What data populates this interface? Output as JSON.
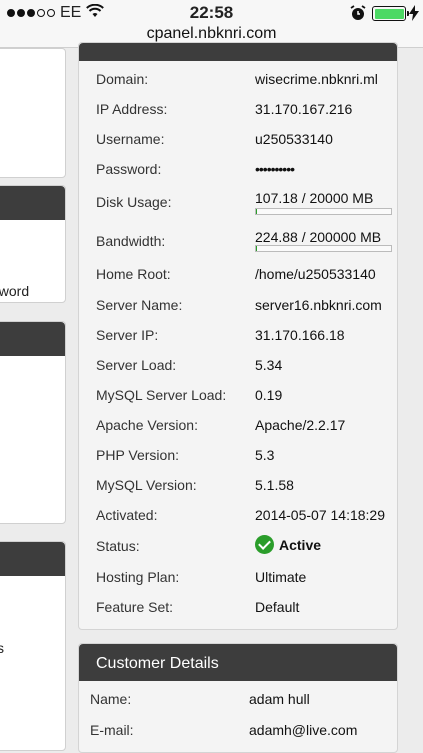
{
  "status_bar": {
    "carrier": "EE",
    "time": "22:58",
    "battery_color": "#4cd964",
    "icons": [
      "signal-dots-icon",
      "wifi-icon",
      "alarm-clock-icon",
      "battery-icon",
      "charging-bolt-icon"
    ]
  },
  "browser": {
    "url": "cpanel.nbknri.com"
  },
  "sidebar": {
    "fragment_1": "eword",
    "fragment_2": "l",
    "fragment_3": "s"
  },
  "account": {
    "domain": {
      "label": "Domain:",
      "value": "wisecrime.nbknri.ml"
    },
    "ip": {
      "label": "IP Address:",
      "value": "31.170.167.216"
    },
    "username": {
      "label": "Username:",
      "value": "u250533140"
    },
    "password": {
      "label": "Password:",
      "value": "••••••••••"
    },
    "disk": {
      "label": "Disk Usage:",
      "value": "107.18 / 20000 MB",
      "used_fraction": 0.0054
    },
    "bandwidth": {
      "label": "Bandwidth:",
      "value": "224.88 / 200000 MB",
      "used_fraction": 0.0011
    },
    "home_root": {
      "label": "Home Root:",
      "value": "/home/u250533140"
    },
    "server_name": {
      "label": "Server Name:",
      "value": "server16.nbknri.com"
    },
    "server_ip": {
      "label": "Server IP:",
      "value": "31.170.166.18"
    },
    "server_load": {
      "label": "Server Load:",
      "value": "5.34"
    },
    "mysql_load": {
      "label": "MySQL Server Load:",
      "value": "0.19"
    },
    "apache": {
      "label": "Apache Version:",
      "value": "Apache/2.2.17"
    },
    "php": {
      "label": "PHP Version:",
      "value": "5.3"
    },
    "mysql_version": {
      "label": "MySQL Version:",
      "value": "5.1.58"
    },
    "activated": {
      "label": "Activated:",
      "value": "2014-05-07 14:18:29"
    },
    "status": {
      "label": "Status:",
      "value": "Active",
      "color": "#2a9d2a"
    },
    "plan": {
      "label": "Hosting Plan:",
      "value": "Ultimate"
    },
    "feature_set": {
      "label": "Feature Set:",
      "value": "Default"
    }
  },
  "customer": {
    "title": "Customer Details",
    "name": {
      "label": "Name:",
      "value": "adam hull"
    },
    "email": {
      "label": "E-mail:",
      "value": "adamh@live.com"
    }
  }
}
